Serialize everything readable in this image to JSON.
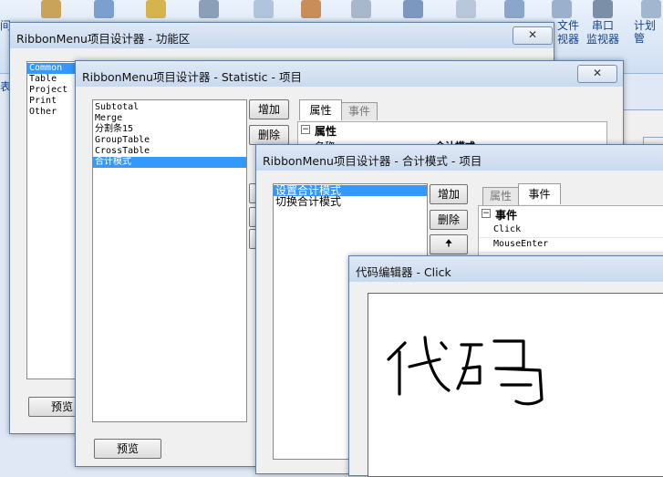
{
  "background": {
    "ribbon_labels": {
      "file_monitor_line1": "文件",
      "file_monitor_line2": "视器",
      "serial_monitor_line1": "串口",
      "serial_monitor_line2": "监视器",
      "planner": "计划管",
      "left_edge_top": "间",
      "left_edge_side": "表"
    },
    "colors": {
      "ribbon": "#dfe8f4",
      "accent": "#15428b"
    }
  },
  "window_functional": {
    "title": "RibbonMenu项目设计器 - 功能区",
    "close_label": "✕",
    "list_items": [
      "Common",
      "Table",
      "Project",
      "Print",
      "Other"
    ],
    "selected_index": 0,
    "preview_label": "预览"
  },
  "window_statistic": {
    "title": "RibbonMenu项目设计器 - Statistic - 项目",
    "close_label": "✕",
    "list_items": [
      "Subtotal",
      "Merge",
      "分割条15",
      "GroupTable",
      "CrossTable",
      "合计模式"
    ],
    "selected_index": 5,
    "add_label": "增加",
    "delete_label": "删除",
    "tab_properties": "属性",
    "tab_events": "事件",
    "grid_category": "属性",
    "grid_name": "名称",
    "grid_value": "合计模式",
    "preview_label": "预览"
  },
  "window_sum_mode": {
    "title": "RibbonMenu项目设计器 - 合计模式 - 项目",
    "list_items": [
      "设置合计模式",
      "切换合计模式"
    ],
    "selected_index": 0,
    "add_label": "增加",
    "delete_label": "删除",
    "up_label": "🠉",
    "tab_properties": "属性",
    "tab_events": "事件",
    "grid_category": "事件",
    "events": [
      "Click",
      "MouseEnter"
    ]
  },
  "window_code_editor": {
    "title": "代码编辑器 - Click",
    "code_text": "代码"
  }
}
